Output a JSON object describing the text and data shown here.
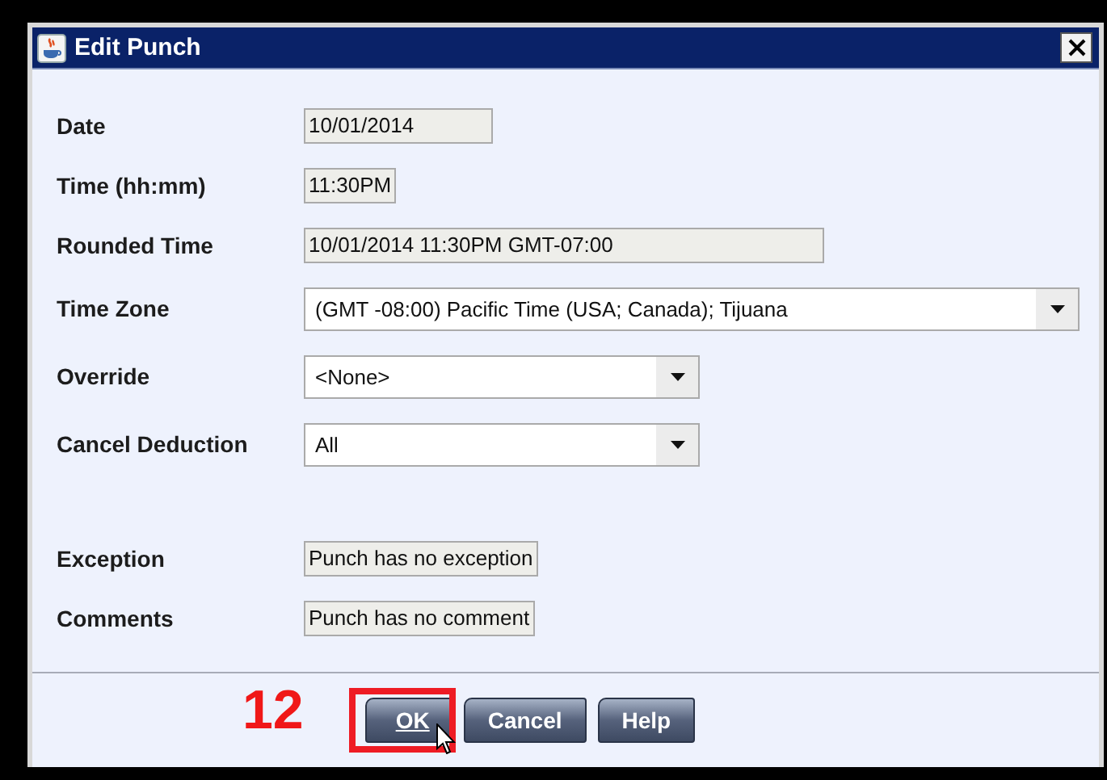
{
  "window": {
    "title": "Edit Punch"
  },
  "fields": [
    {
      "label": "Date",
      "kind": "text",
      "value": "10/01/2014"
    },
    {
      "label": "Time (hh:mm)",
      "kind": "text",
      "value": "11:30PM"
    },
    {
      "label": "Rounded Time",
      "kind": "text",
      "value": "10/01/2014 11:30PM GMT-07:00"
    },
    {
      "label": "Time Zone",
      "kind": "combo",
      "value": "(GMT -08:00) Pacific Time (USA; Canada); Tijuana"
    },
    {
      "label": "Override",
      "kind": "combo",
      "value": "<None>"
    },
    {
      "label": "Cancel Deduction",
      "kind": "combo",
      "value": "All"
    },
    {
      "label": "Exception",
      "kind": "text",
      "value": "Punch has no exception"
    },
    {
      "label": "Comments",
      "kind": "text",
      "value": "Punch has no comment"
    }
  ],
  "annotation": {
    "label": "12"
  },
  "buttons": [
    {
      "label": "OK",
      "highlighted": true
    },
    {
      "label": "Cancel",
      "highlighted": false
    },
    {
      "label": "Help",
      "highlighted": false
    }
  ]
}
